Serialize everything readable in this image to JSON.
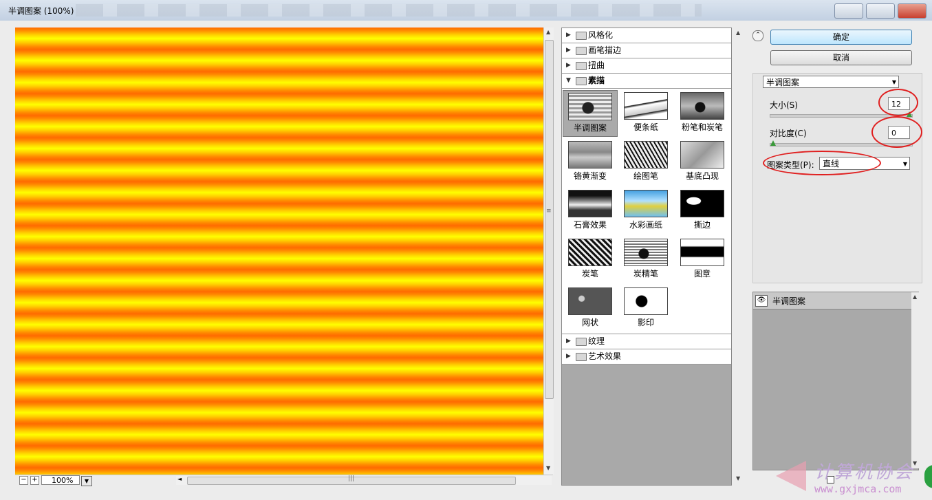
{
  "window": {
    "title": "半调图案 (100%)"
  },
  "preview": {
    "zoom": "100%",
    "zoom_out": "−",
    "zoom_in": "+"
  },
  "gallery": {
    "categories_top": [
      "风格化",
      "画笔描边",
      "扭曲"
    ],
    "open_category": "素描",
    "thumbs": [
      "半调图案",
      "便条纸",
      "粉笔和炭笔",
      "铬黄渐变",
      "绘图笔",
      "基底凸现",
      "石膏效果",
      "水彩画纸",
      "撕边",
      "炭笔",
      "炭精笔",
      "图章",
      "网状",
      "影印"
    ],
    "categories_bottom": [
      "纹理",
      "艺术效果"
    ]
  },
  "buttons": {
    "ok": "确定",
    "cancel": "取消"
  },
  "filter_select": "半调图案",
  "params": {
    "size_label": "大小(S)",
    "size_value": "12",
    "size_fraction": 1.0,
    "contrast_label": "对比度(C)",
    "contrast_value": "0",
    "contrast_fraction": 0.0,
    "pattern_type_label": "图案类型(P):",
    "pattern_type_value": "直线"
  },
  "layers": {
    "item": "半调图案"
  },
  "watermark": {
    "text": "计算机协会",
    "url": "www.gxjmca.com"
  },
  "colors": {
    "stripe_orange": "#ff6a00",
    "stripe_yellow": "#ffff00",
    "highlight_ring": "#e02020"
  }
}
